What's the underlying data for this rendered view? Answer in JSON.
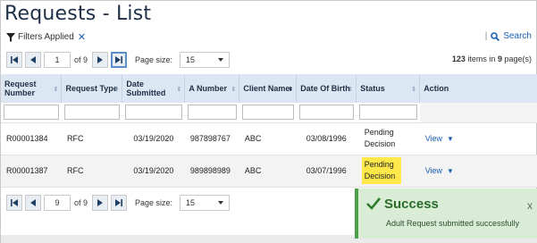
{
  "page": {
    "title": "Requests - List"
  },
  "filters": {
    "label": "Filters Applied",
    "clear_icon": "close-icon",
    "divider": "|",
    "search_label": "Search"
  },
  "pager_top": {
    "current_page": "1",
    "of_label": "of 9",
    "page_size_label": "Page size:",
    "page_size_value": "15",
    "items_count": "123",
    "items_mid": "items in",
    "pages_count": "9",
    "pages_suffix": "page(s)"
  },
  "pager_bottom": {
    "current_page": "9",
    "of_label": "of 9",
    "page_size_label": "Page size:",
    "page_size_value": "15"
  },
  "table": {
    "columns": [
      "Request Number",
      "Request Type",
      "Date Submitted",
      "A Number",
      "Client Name",
      "Date Of Birth",
      "Status",
      "Action"
    ],
    "rows": [
      {
        "request_number": "R00001384",
        "request_type": "RFC",
        "date_submitted": "03/19/2020",
        "a_number": "987898767",
        "client_name": "ABC",
        "dob": "03/08/1996",
        "status": "Pending Decision",
        "action": "View"
      },
      {
        "request_number": "R00001387",
        "request_type": "RFC",
        "date_submitted": "03/19/2020",
        "a_number": "989898989",
        "client_name": "ABC",
        "dob": "03/07/1996",
        "status": "Pending Decision",
        "action": "View"
      }
    ]
  },
  "toast": {
    "title": "Success",
    "message": "Adult Request submitted successfully",
    "close": "x"
  },
  "colors": {
    "header_bg": "#dbe7f3",
    "link": "#1a5fb4",
    "highlight": "#ffe84a",
    "toast_bg": "#d9edd6"
  }
}
